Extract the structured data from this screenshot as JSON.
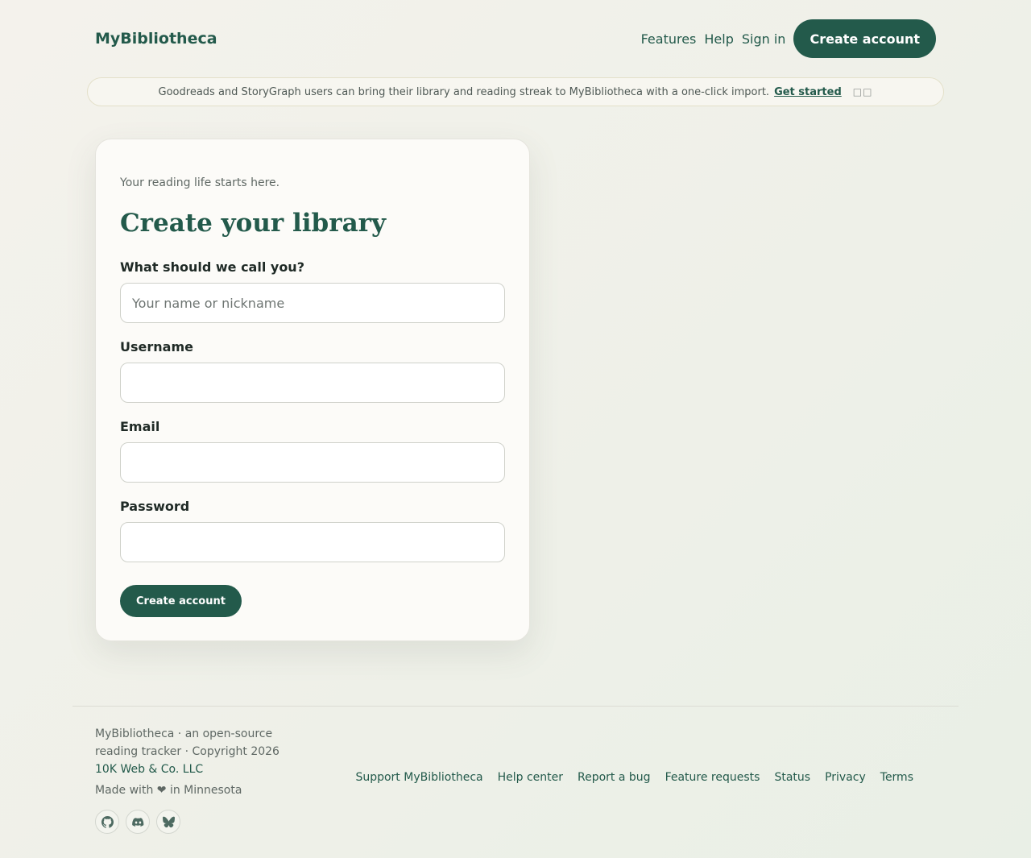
{
  "header": {
    "brand": "MyBibliotheca",
    "nav": {
      "features": "Features",
      "help": "Help",
      "sign_in": "Sign in",
      "create_account": "Create account"
    }
  },
  "banner": {
    "text": "Goodreads and StoryGraph users can bring their library and reading streak to MyBibliotheca with a one-click import.",
    "link": "Get started",
    "close_glyph": "□□"
  },
  "form": {
    "eyebrow": "Your reading life starts here.",
    "title": "Create your library",
    "name": {
      "label": "What should we call you?",
      "placeholder": "Your name or nickname",
      "value": ""
    },
    "username": {
      "label": "Username",
      "value": ""
    },
    "email": {
      "label": "Email",
      "value": ""
    },
    "password": {
      "label": "Password",
      "value": ""
    },
    "submit": "Create account"
  },
  "footer": {
    "line1": "MyBibliotheca · an open-source reading tracker · Copyright 2026",
    "company": "10K Web & Co. LLC",
    "made": "Made with ❤ in Minnesota",
    "social_icons": [
      "github-icon",
      "discord-icon",
      "bluesky-icon"
    ],
    "links": [
      "Support MyBibliotheca",
      "Help center",
      "Report a bug",
      "Feature requests",
      "Status",
      "Privacy",
      "Terms"
    ]
  },
  "colors": {
    "accent": "#235a4b",
    "background": "#f2f2eb"
  }
}
